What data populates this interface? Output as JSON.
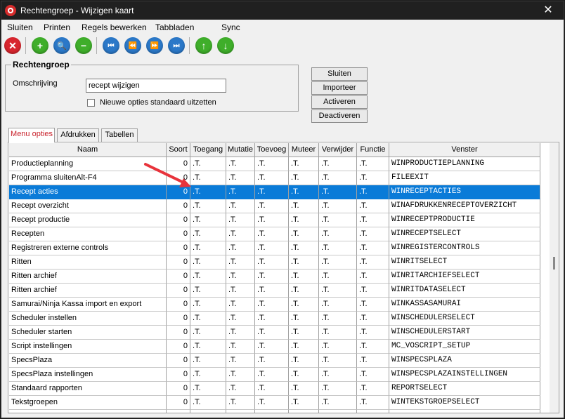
{
  "window": {
    "title": "Rechtengroep - Wijzigen kaart",
    "close_glyph": "✕"
  },
  "menu": [
    "Sluiten",
    "Printen",
    "Regels bewerken",
    "Tabbladen",
    "Sync"
  ],
  "toolbar": [
    {
      "icon": "close-icon",
      "color": "#d8262e",
      "glyph": "✕"
    },
    {
      "icon": "plus-icon",
      "color": "#3fae2a",
      "glyph": "+"
    },
    {
      "icon": "search-icon",
      "color": "#2b78c8",
      "glyph": "🔍"
    },
    {
      "icon": "minus-icon",
      "color": "#3fae2a",
      "glyph": "−"
    },
    {
      "icon": "first-record-icon",
      "color": "#2b78c8",
      "glyph": "⏮"
    },
    {
      "icon": "previous-record-icon",
      "color": "#2b78c8",
      "glyph": "⏪"
    },
    {
      "icon": "next-record-icon",
      "color": "#2b78c8",
      "glyph": "⏩"
    },
    {
      "icon": "last-record-icon",
      "color": "#2b78c8",
      "glyph": "⏭"
    },
    {
      "icon": "arrow-up-icon",
      "color": "#3fae2a",
      "glyph": "↑"
    },
    {
      "icon": "arrow-down-icon",
      "color": "#3fae2a",
      "glyph": "↓"
    }
  ],
  "group": {
    "title": "Rechtengroep",
    "omschrijving_label": "Omschrijving",
    "omschrijving_value": "recept wijzigen",
    "checkbox_label": "Nieuwe opties standaard uitzetten",
    "checkbox_checked": false
  },
  "buttons": {
    "sluiten": "Sluiten",
    "importeer": "Importeer",
    "activeren": "Activeren",
    "deactiveren": "Deactiveren"
  },
  "tabs": [
    "Menu opties",
    "Afdrukken",
    "Tabellen"
  ],
  "grid": {
    "columns": [
      "Naam",
      "Soort",
      "Toegang",
      "Mutatie",
      "Toevoeg",
      "Muteer",
      "Verwijder",
      "Functie",
      "Venster"
    ],
    "selected_row": 2,
    "rows": [
      [
        "Productieplanning",
        "0",
        ".T.",
        ".T.",
        ".T.",
        ".T.",
        ".T.",
        ".T.",
        "WINPRODUCTIEPLANNING"
      ],
      [
        "Programma sluitenAlt-F4",
        "0",
        ".T.",
        ".T.",
        ".T.",
        ".T.",
        ".T.",
        ".T.",
        "FILEEXIT"
      ],
      [
        "Recept acties",
        "0",
        ".T.",
        ".T.",
        ".T.",
        ".T.",
        ".T.",
        ".T.",
        "WINRECEPTACTIES"
      ],
      [
        "Recept overzicht",
        "0",
        ".T.",
        ".T.",
        ".T.",
        ".T.",
        ".T.",
        ".T.",
        "WINAFDRUKKENRECEPTOVERZICHT"
      ],
      [
        "Recept productie",
        "0",
        ".T.",
        ".T.",
        ".T.",
        ".T.",
        ".T.",
        ".T.",
        "WINRECEPTPRODUCTIE"
      ],
      [
        "Recepten",
        "0",
        ".T.",
        ".T.",
        ".T.",
        ".T.",
        ".T.",
        ".T.",
        "WINRECEPTSELECT"
      ],
      [
        "Registreren externe controls",
        "0",
        ".T.",
        ".T.",
        ".T.",
        ".T.",
        ".T.",
        ".T.",
        "WINREGISTERCONTROLS"
      ],
      [
        "Ritten",
        "0",
        ".T.",
        ".T.",
        ".T.",
        ".T.",
        ".T.",
        ".T.",
        "WINRITSELECT"
      ],
      [
        "Ritten archief",
        "0",
        ".T.",
        ".T.",
        ".T.",
        ".T.",
        ".T.",
        ".T.",
        "WINRITARCHIEFSELECT"
      ],
      [
        "Ritten archief",
        "0",
        ".T.",
        ".T.",
        ".T.",
        ".T.",
        ".T.",
        ".T.",
        "WINRITDATASELECT"
      ],
      [
        "Samurai/Ninja Kassa import en export",
        "0",
        ".T.",
        ".T.",
        ".T.",
        ".T.",
        ".T.",
        ".T.",
        "WINKASSASAMURAI"
      ],
      [
        "Scheduler instellen",
        "0",
        ".T.",
        ".T.",
        ".T.",
        ".T.",
        ".T.",
        ".T.",
        "WINSCHEDULERSELECT"
      ],
      [
        "Scheduler starten",
        "0",
        ".T.",
        ".T.",
        ".T.",
        ".T.",
        ".T.",
        ".T.",
        "WINSCHEDULERSTART"
      ],
      [
        "Script instellingen",
        "0",
        ".T.",
        ".T.",
        ".T.",
        ".T.",
        ".T.",
        ".T.",
        "MC_VOSCRIPT_SETUP"
      ],
      [
        "SpecsPlaza",
        "0",
        ".T.",
        ".T.",
        ".T.",
        ".T.",
        ".T.",
        ".T.",
        "WINSPECSPLAZA"
      ],
      [
        "SpecsPlaza instellingen",
        "0",
        ".T.",
        ".T.",
        ".T.",
        ".T.",
        ".T.",
        ".T.",
        "WINSPECSPLAZAINSTELLINGEN"
      ],
      [
        "Standaard rapporten",
        "0",
        ".T.",
        ".T.",
        ".T.",
        ".T.",
        ".T.",
        ".T.",
        "REPORTSELECT"
      ],
      [
        "Tekstgroepen",
        "0",
        ".T.",
        ".T.",
        ".T.",
        ".T.",
        ".T.",
        ".T.",
        "WINTEKSTGROEPSELECT"
      ],
      [
        "",
        "",
        "",
        "",
        "",
        "",
        "",
        "",
        ""
      ]
    ]
  },
  "colors": {
    "selection": "#0a7bd8",
    "annotation_arrow": "#e8333b",
    "active_tab_text": "#c8202a"
  }
}
